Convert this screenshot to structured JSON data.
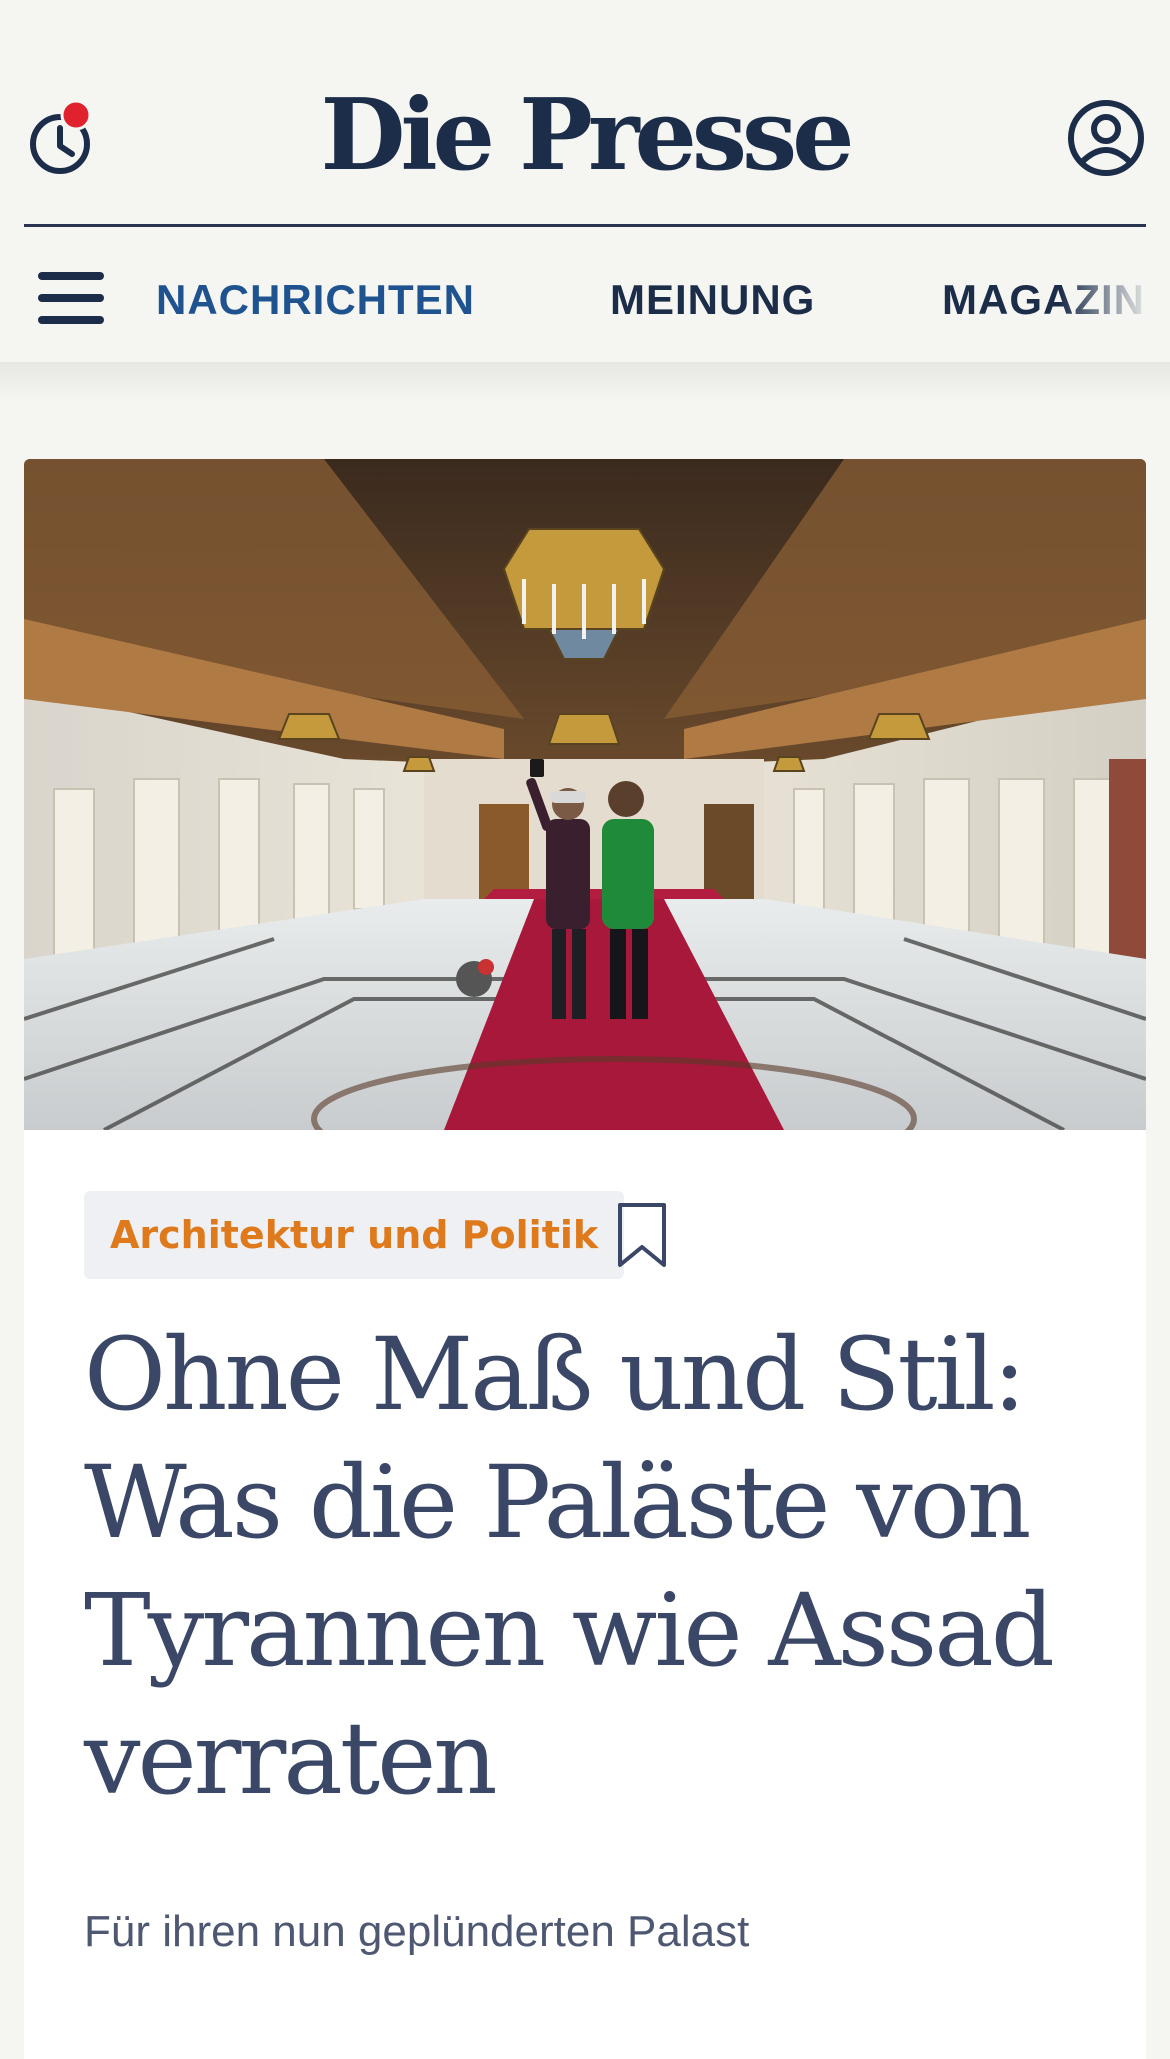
{
  "header": {
    "logo": "Die Presse",
    "history_icon": "clock-icon",
    "history_badge_color": "#e0212e",
    "account_icon": "user-circle-icon"
  },
  "nav": {
    "menu_icon": "hamburger-menu-icon",
    "items": [
      {
        "label": "NACHRICHTEN",
        "active": true
      },
      {
        "label": "MEINUNG",
        "active": false
      },
      {
        "label": "MAGAZIN",
        "active": false
      }
    ]
  },
  "article": {
    "image_alt": "Zwei Männer machen ein Selfie in einer prunkvollen Palasthalle mit Kronleuchtern und rotem Teppich",
    "category": "Architektur und Politik",
    "bookmark_icon": "bookmark-icon",
    "headline": "Ohne Maß und Stil: Was die Paläste von Tyrannen wie Assad verraten",
    "lead": "Für ihren nun geplünderten Palast"
  },
  "colors": {
    "brand_navy": "#1c2d4a",
    "nav_active": "#1f5390",
    "category_orange": "#df7a1c",
    "headline": "#3b4766",
    "background": "#f5f5f2"
  }
}
